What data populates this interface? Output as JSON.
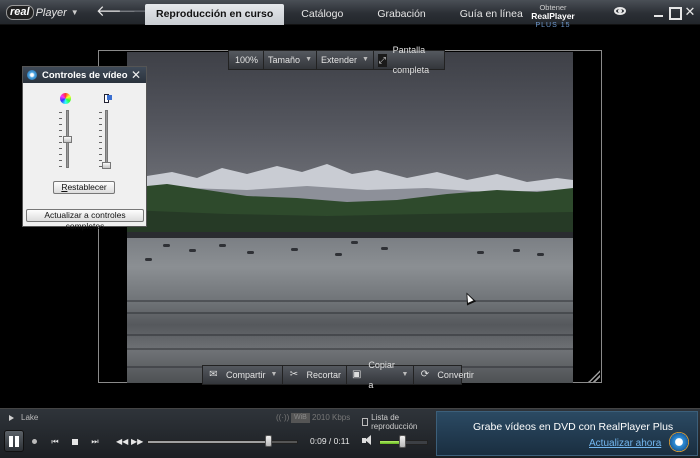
{
  "app": {
    "logo_real": "real",
    "logo_player": "Player"
  },
  "tabs": [
    {
      "label": "Reproducción en curso",
      "active": true
    },
    {
      "label": "Catálogo"
    },
    {
      "label": "Grabación"
    },
    {
      "label": "Guía en línea"
    }
  ],
  "upgrade": {
    "line1": "Obtener",
    "line1_bold": "RealPlayer",
    "line2": "PLUS 15"
  },
  "size_bar": {
    "zoom": "100%",
    "size": "Tamaño",
    "extend": "Extender",
    "fullscreen": "Pantalla completa"
  },
  "action_bar": {
    "share": "Compartir",
    "trim": "Recortar",
    "copy": "Copiar a",
    "convert": "Convertir"
  },
  "video_controls": {
    "title": "Controles de vídeo",
    "reset_first": "R",
    "reset_rest": "establecer",
    "full_controls": "Actualizar a controles completos"
  },
  "status": {
    "clip_title": "Lake",
    "quality": "WiB",
    "bitrate": "2010 Kbps",
    "playlist": "Lista de reproducción"
  },
  "playback": {
    "time": "0:09 / 0:11",
    "progress": 0.82,
    "volume": 0.5
  },
  "promo": {
    "text": "Grabe vídeos en DVD con RealPlayer Plus",
    "link": "Actualizar ahora"
  }
}
